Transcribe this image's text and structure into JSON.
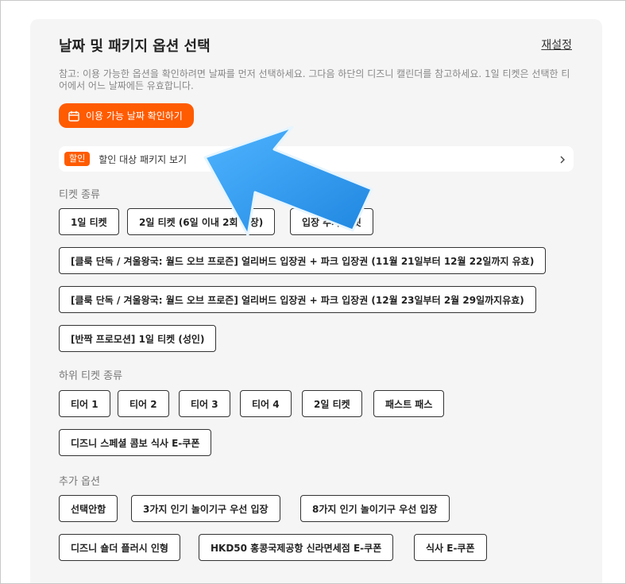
{
  "panel": {
    "title": "날짜 및 패키지 옵션 선택",
    "reset_label": "재설정",
    "note": "참고: 이용 가능한 옵션을 확인하려면 날짜를 먼저 선택하세요. 그다음 하단의 디즈니 캘린더를 참고하세요. 1일 티켓은 선택한 티어에서 어느 날짜에든 유효합니다.",
    "check_dates_button": {
      "icon": "calendar-icon",
      "label": "이용 가능 날짜 확인하기"
    },
    "promo": {
      "badge": "할인",
      "label": "할인 대상 패키지 보기",
      "icon": "chevron-right-icon"
    }
  },
  "ticket_type": {
    "label": "티켓 종류",
    "options": [
      "1일 티켓",
      "2일 티켓 (6일 이내 2회 입장)",
      "입장 추가 티켓",
      "[클룩 단독 / 겨울왕국: 월드 오브 프로즌] 얼리버드 입장권 + 파크 입장권 (11월 21일부터 12월 22일까지 유효)",
      "[클룩 단독 / 겨울왕국: 월드 오브 프로즌] 얼리버드 입장권 + 파크 입장권 (12월 23일부터 2월 29일까지유효)",
      "[반짝 프로모션] 1일 티켓 (성인)"
    ]
  },
  "sub_ticket_type": {
    "label": "하위 티켓 종류",
    "options": [
      "티어 1",
      "티어 2",
      "티어 3",
      "티어 4",
      "2일 티켓",
      "패스트 패스",
      "디즈니 스페셜 콤보 식사 E-쿠폰"
    ]
  },
  "extra_options": {
    "label": "추가 옵션",
    "options": [
      "선택안함",
      "3가지 인기 놀이기구 우선 입장",
      "8가지 인기 놀이기구 우선 입장",
      "디즈니 숄더 플러시 인형",
      "HKD50 홍콩국제공항 신라면세점 E-쿠폰",
      "식사 E-쿠폰"
    ]
  },
  "colors": {
    "accent": "#ff5b00",
    "annotation_arrow": "#2f9bf0"
  }
}
